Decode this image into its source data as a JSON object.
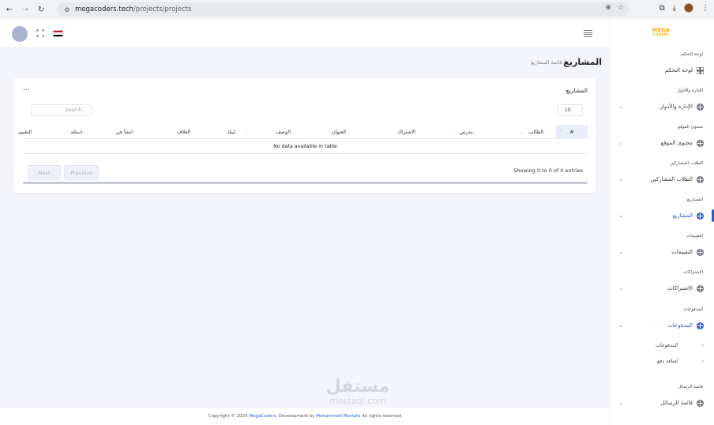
{
  "browser": {
    "url_host": "megacoders.tech",
    "url_path": "/projects/projects"
  },
  "header": {
    "flag_colors": [
      "#ce1126",
      "#ffffff",
      "#000000"
    ]
  },
  "logo": {
    "line1": "MEGA",
    "line2": "CODERS"
  },
  "sidebar": {
    "sections": [
      {
        "title": "لوحة التحكم",
        "item": "لوحة التحكم",
        "icon": "dashboard-icon",
        "chevron": false
      },
      {
        "title": "الإدارة والأدوار",
        "item": "الإدارة والأدوار",
        "icon": "globe-icon",
        "chevron": true
      },
      {
        "title": "محتوى الموقع",
        "item": "محتوى الموقع",
        "icon": "globe-icon",
        "chevron": true
      },
      {
        "title": "الطلاب المشاركين",
        "item": "الطلاب المشاركين",
        "icon": "globe-icon",
        "chevron": true
      },
      {
        "title": "المشاريع",
        "item": "المشاريع",
        "icon": "globe-icon",
        "chevron": true,
        "active": true
      },
      {
        "title": "التقييمات",
        "item": "التقييمات",
        "icon": "globe-icon",
        "chevron": true
      },
      {
        "title": "الاشتراكات",
        "item": "الاشتراكات",
        "icon": "globe-icon",
        "chevron": true
      },
      {
        "title": "المدفوعات",
        "item": "المدفوعات",
        "icon": "globe-icon",
        "chevron": true,
        "expanded": true
      },
      {
        "title": "قائمة الرسائل",
        "item": "قائمة الرسائل",
        "icon": "globe-icon",
        "chevron": true
      }
    ],
    "payments_sub": [
      "المدفوعات",
      "اضافة دفع"
    ],
    "accent": "#2a5bd7"
  },
  "page": {
    "title": "المشاريع",
    "breadcrumb": "/ قائمة المشاريع"
  },
  "card": {
    "title": "المشاريع",
    "menu": "...",
    "page_length": "10",
    "search_placeholder": "Search...",
    "columns": [
      "#",
      "الطالب",
      "مدرس",
      "الاشتراك",
      "العنوان",
      "الوصف",
      "لينك",
      "الغلاف",
      "انشأ في",
      "اسئلة",
      "التقييم"
    ],
    "empty_text": "No data available in table",
    "info": "Showing 0 to 0 of 0 entries",
    "next_label": "Next",
    "previous_label": "Previous"
  },
  "footer": {
    "prefix": "Copyright © 2025",
    "brand": "MegaCoders",
    "middle": ". Development by",
    "author": "Mohammed Mostafa",
    "suffix": "All rights reserved"
  },
  "watermark": {
    "line1": "مستقل",
    "line2": "mostaql.com"
  }
}
